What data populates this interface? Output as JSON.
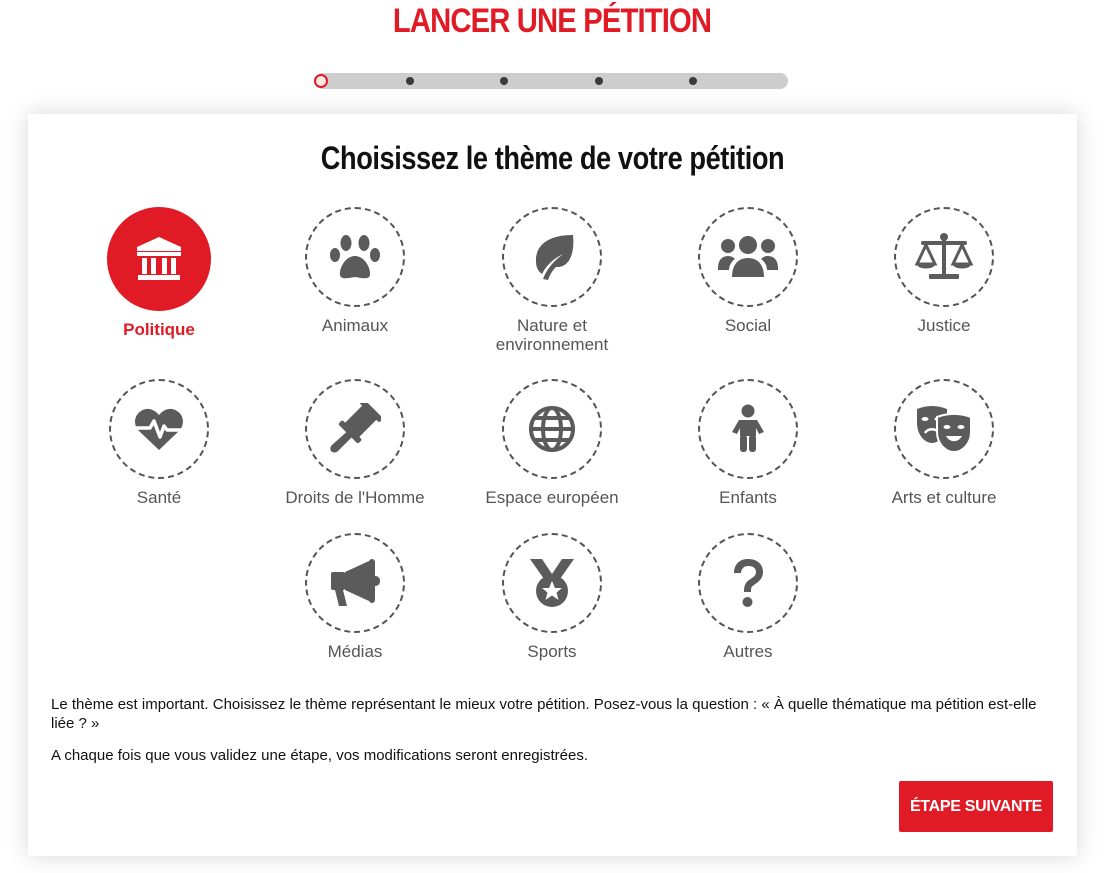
{
  "page": {
    "title": "LANCER UNE PÉTITION"
  },
  "progress": {
    "current_step": 1,
    "total_steps": 6
  },
  "card": {
    "title": "Choisissez le thème de votre pétition",
    "themes": [
      {
        "label": "Politique",
        "icon": "landmark-icon",
        "selected": true
      },
      {
        "label": "Animaux",
        "icon": "paw-icon",
        "selected": false
      },
      {
        "label": "Nature et environnement",
        "icon": "leaf-icon",
        "selected": false
      },
      {
        "label": "Social",
        "icon": "users-icon",
        "selected": false
      },
      {
        "label": "Justice",
        "icon": "scale-icon",
        "selected": false
      },
      {
        "label": "Santé",
        "icon": "heartbeat-icon",
        "selected": false
      },
      {
        "label": "Droits de l'Homme",
        "icon": "gavel-icon",
        "selected": false
      },
      {
        "label": "Espace européen",
        "icon": "globe-icon",
        "selected": false
      },
      {
        "label": "Enfants",
        "icon": "child-icon",
        "selected": false
      },
      {
        "label": "Arts et culture",
        "icon": "theater-masks-icon",
        "selected": false
      },
      {
        "label": "Médias",
        "icon": "megaphone-icon",
        "selected": false
      },
      {
        "label": "Sports",
        "icon": "medal-icon",
        "selected": false
      },
      {
        "label": "Autres",
        "icon": "question-icon",
        "selected": false
      }
    ],
    "help_text_1": "Le thème est important. Choisissez le thème représentant le mieux votre pétition. Posez-vous la question : « À quelle thématique ma pétition est-elle liée ? »",
    "help_text_2": "A chaque fois que vous validez une étape, vos modifications seront enregistrées.",
    "next_label": "ÉTAPE SUIVANTE"
  },
  "colors": {
    "accent": "#e01b25",
    "icon_gray": "#5b5b5b",
    "label_gray": "#555555"
  }
}
